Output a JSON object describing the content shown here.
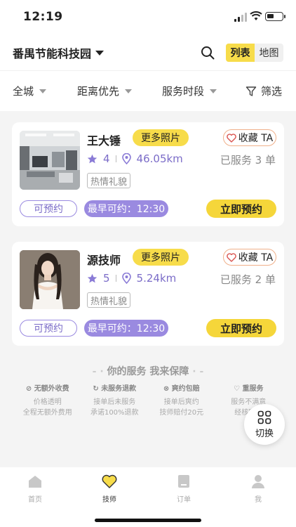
{
  "status": {
    "time": "12:19"
  },
  "header": {
    "location": "番禺节能科技园",
    "view_list": "列表",
    "view_map": "地图"
  },
  "filters": {
    "city": "全城",
    "distance": "距离优先",
    "time_slot": "服务时段",
    "screen": "筛选"
  },
  "therapists": [
    {
      "name": "王大锤",
      "more_photos": "更多照片",
      "favorite": "收藏 TA",
      "rating": "4",
      "distance": "46.05km",
      "served": "已服务 3 单",
      "tag": "热情礼貌",
      "status": "可预约",
      "earliest": "最早可约：12:30",
      "book": "立即预约"
    },
    {
      "name": "源技师",
      "more_photos": "更多照片",
      "favorite": "收藏 TA",
      "rating": "5",
      "distance": "5.24km",
      "served": "已服务 2 单",
      "tag": "热情礼貌",
      "status": "可预约",
      "earliest": "最早可约：12:30",
      "book": "立即预约"
    }
  ],
  "guarantee": {
    "title": "你的服务  我来保障",
    "items": [
      {
        "title": "无额外收费",
        "line1": "价格透明",
        "line2": "全程无额外费用"
      },
      {
        "title": "未服务退款",
        "line1": "接单后未服务",
        "line2": "承诺100%退款"
      },
      {
        "title": "爽约包赔",
        "line1": "接单后爽约",
        "line2": "技师赔付20元"
      },
      {
        "title": "重服务",
        "line1": "服务不满意",
        "line2": "经核实再"
      }
    ]
  },
  "switch_label": "切换",
  "tabs": [
    "首页",
    "技师",
    "订单",
    "我"
  ],
  "colors": {
    "accent_yellow": "#f7dc4a",
    "accent_purple": "#9a8ae0"
  }
}
